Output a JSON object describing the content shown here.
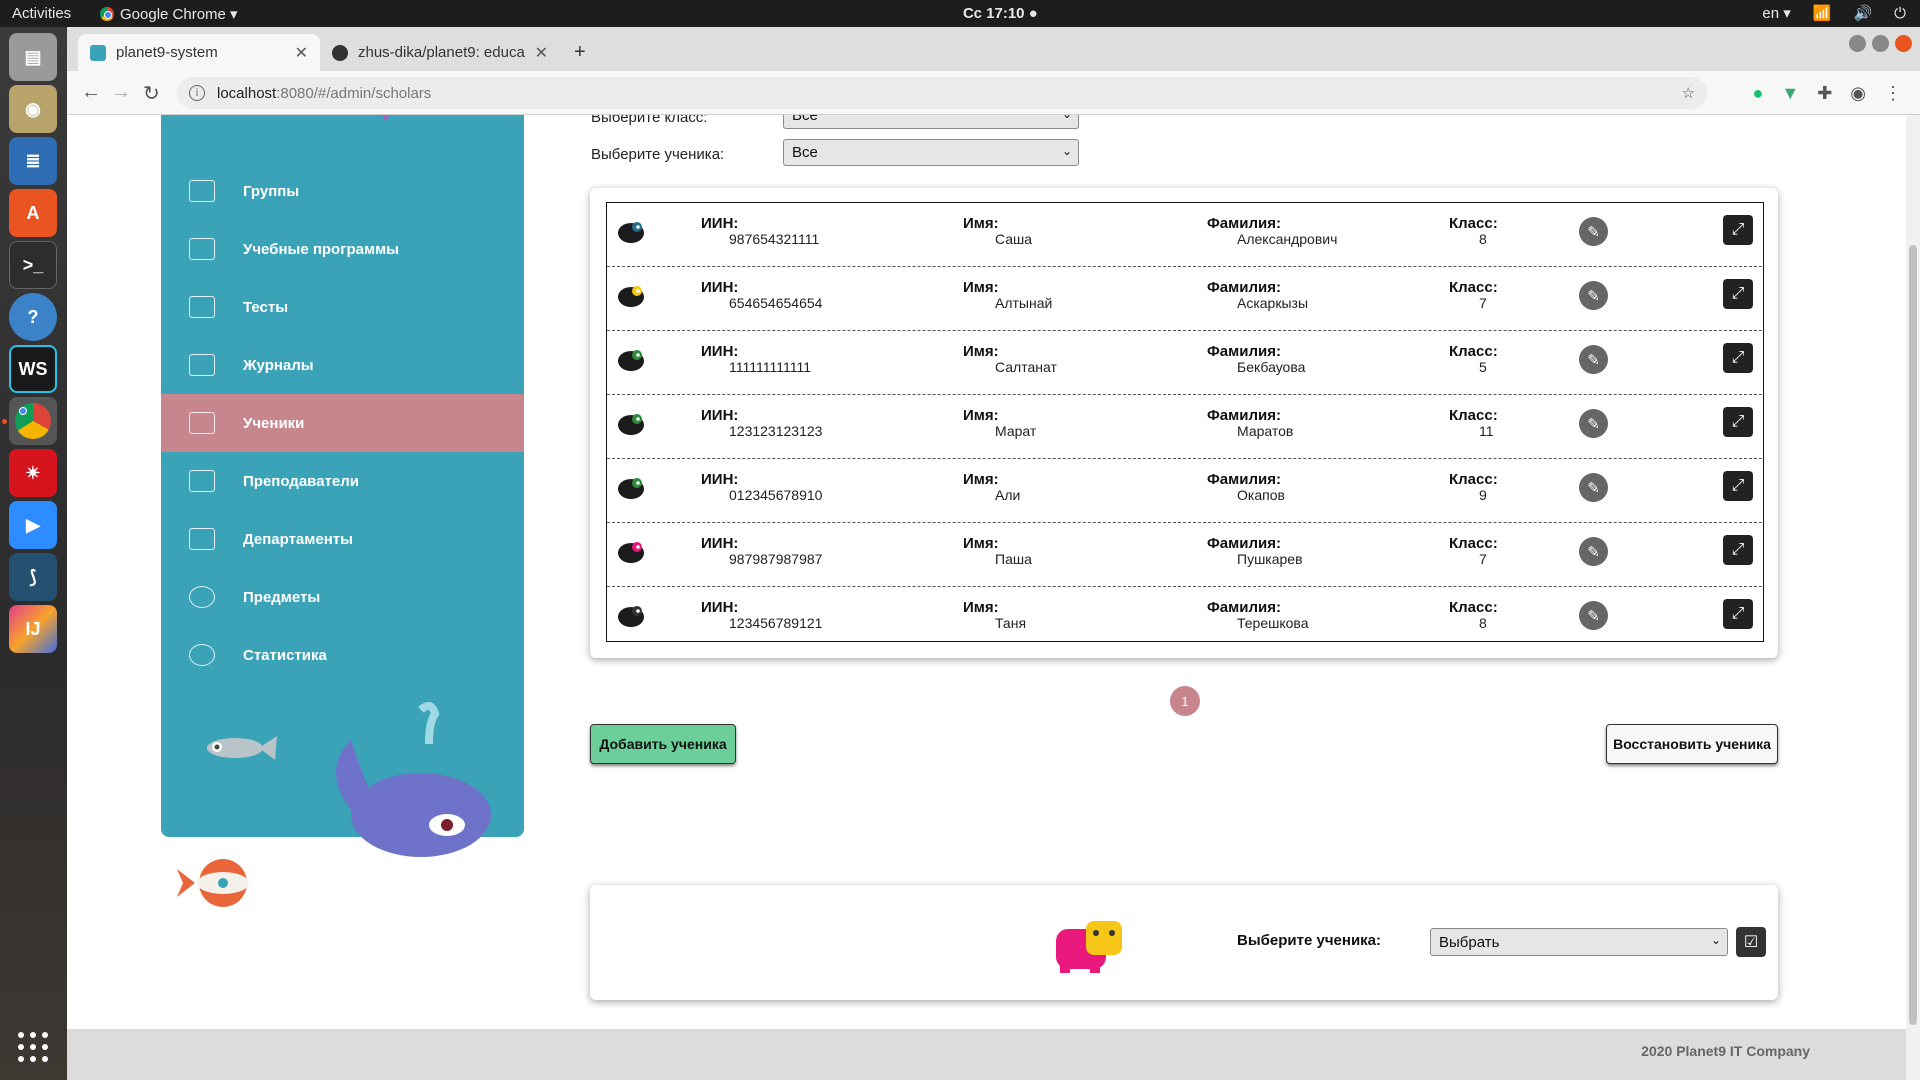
{
  "topbar": {
    "activities": "Activities",
    "app_name": "Google Chrome ▾",
    "clock": "Сс 17:10 ●",
    "lang": "en ▾"
  },
  "browser": {
    "tabs": [
      {
        "title": "planet9-system"
      },
      {
        "title": "zhus-dika/planet9: educa"
      }
    ],
    "url_host": "localhost",
    "url_path": ":8080/#/admin/scholars"
  },
  "sidebar": {
    "items": [
      {
        "label": "Группы",
        "icon": "groups-icon"
      },
      {
        "label": "Учебные программы",
        "icon": "curriculum-icon"
      },
      {
        "label": "Тесты",
        "icon": "tests-icon"
      },
      {
        "label": "Журналы",
        "icon": "journals-icon"
      },
      {
        "label": "Ученики",
        "icon": "students-icon",
        "active": true
      },
      {
        "label": "Преподаватели",
        "icon": "teachers-icon"
      },
      {
        "label": "Департаменты",
        "icon": "departments-icon"
      },
      {
        "label": "Предметы",
        "icon": "subjects-icon"
      },
      {
        "label": "Статистика",
        "icon": "statistics-icon"
      }
    ]
  },
  "filters": {
    "class_label": "Выберите класс:",
    "class_value": "Все",
    "student_label": "Выберите ученика:",
    "student_value": "Все"
  },
  "table": {
    "labels": {
      "iin": "ИИН:",
      "name": "Имя:",
      "surname": "Фамилия:",
      "class": "Класс:"
    },
    "rows": [
      {
        "animal": "dolphin-icon",
        "iin": "987654321111",
        "name": "Саша",
        "surname": "Александрович",
        "class": "8"
      },
      {
        "animal": "bird-icon",
        "iin": "654654654654",
        "name": "Алтынай",
        "surname": "Аскаркызы",
        "class": "7"
      },
      {
        "animal": "chameleon-icon",
        "iin": "111111111111",
        "name": "Салтанат",
        "surname": "Бекбауова",
        "class": "5"
      },
      {
        "animal": "cat-icon",
        "iin": "123123123123",
        "name": "Марат",
        "surname": "Маратов",
        "class": "11"
      },
      {
        "animal": "ostrich-icon",
        "iin": "012345678910",
        "name": "Али",
        "surname": "Окапов",
        "class": "9"
      },
      {
        "animal": "flamingo-icon",
        "iin": "987987987987",
        "name": "Паша",
        "surname": "Пушкарев",
        "class": "7"
      },
      {
        "animal": "sloth-icon",
        "iin": "123456789121",
        "name": "Таня",
        "surname": "Терешкова",
        "class": "8"
      }
    ]
  },
  "pagination": {
    "current": "1"
  },
  "actions": {
    "add_label": "Добавить ученика",
    "restore_label": "Восстановить ученика"
  },
  "select_card": {
    "label": "Выберите ученика:",
    "value": "Выбрать"
  },
  "footer": {
    "copyright": "2020 Planet9 IT Company"
  },
  "colors": {
    "sidebar": "#3aa3b8",
    "active_item": "#c7868d",
    "add_button": "#6ccf9a"
  }
}
